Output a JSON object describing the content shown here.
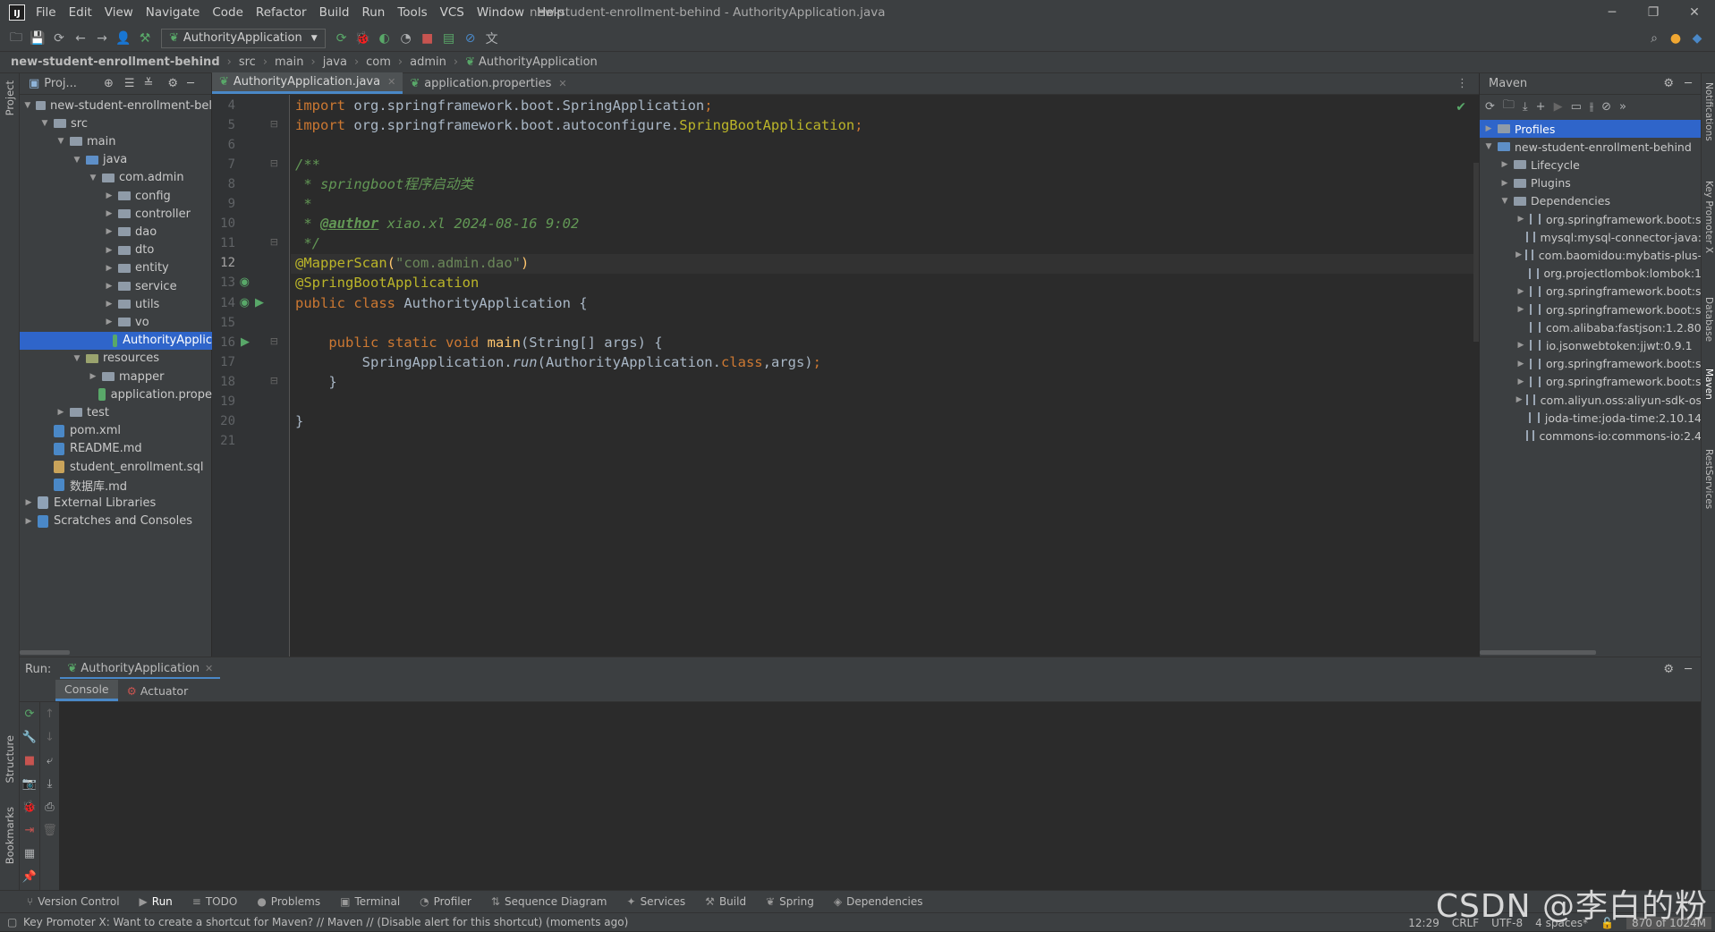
{
  "window": {
    "title": "new-student-enrollment-behind - AuthorityApplication.java",
    "menu": [
      "File",
      "Edit",
      "View",
      "Navigate",
      "Code",
      "Refactor",
      "Build",
      "Run",
      "Tools",
      "VCS",
      "Window",
      "Help"
    ]
  },
  "toolbar": {
    "run_config": "AuthorityApplication"
  },
  "breadcrumb": [
    "new-student-enrollment-behind",
    "src",
    "main",
    "java",
    "com",
    "admin",
    "AuthorityApplication"
  ],
  "left_strip": {
    "project": "Project",
    "structure": "Structure",
    "bookmarks": "Bookmarks"
  },
  "project": {
    "header": "Proj...",
    "tree": [
      {
        "label": "new-student-enrollment-bel",
        "indent": 0,
        "arrow": "v",
        "kind": "folder"
      },
      {
        "label": "src",
        "indent": 1,
        "arrow": "v",
        "kind": "folder"
      },
      {
        "label": "main",
        "indent": 2,
        "arrow": "v",
        "kind": "folder"
      },
      {
        "label": "java",
        "indent": 3,
        "arrow": "v",
        "kind": "blue"
      },
      {
        "label": "com.admin",
        "indent": 4,
        "arrow": "v",
        "kind": "folder"
      },
      {
        "label": "config",
        "indent": 5,
        "arrow": ">",
        "kind": "folder"
      },
      {
        "label": "controller",
        "indent": 5,
        "arrow": ">",
        "kind": "folder"
      },
      {
        "label": "dao",
        "indent": 5,
        "arrow": ">",
        "kind": "folder"
      },
      {
        "label": "dto",
        "indent": 5,
        "arrow": ">",
        "kind": "folder"
      },
      {
        "label": "entity",
        "indent": 5,
        "arrow": ">",
        "kind": "folder"
      },
      {
        "label": "service",
        "indent": 5,
        "arrow": ">",
        "kind": "folder"
      },
      {
        "label": "utils",
        "indent": 5,
        "arrow": ">",
        "kind": "folder"
      },
      {
        "label": "vo",
        "indent": 5,
        "arrow": ">",
        "kind": "folder"
      },
      {
        "label": "AuthorityApplic",
        "indent": 5,
        "arrow": "",
        "kind": "spring",
        "selected": true
      },
      {
        "label": "resources",
        "indent": 3,
        "arrow": "v",
        "kind": "res"
      },
      {
        "label": "mapper",
        "indent": 4,
        "arrow": ">",
        "kind": "folder"
      },
      {
        "label": "application.prope",
        "indent": 4,
        "arrow": "",
        "kind": "props"
      },
      {
        "label": "test",
        "indent": 2,
        "arrow": ">",
        "kind": "folder"
      },
      {
        "label": "pom.xml",
        "indent": 1,
        "arrow": "",
        "kind": "maven"
      },
      {
        "label": "README.md",
        "indent": 1,
        "arrow": "",
        "kind": "md"
      },
      {
        "label": "student_enrollment.sql",
        "indent": 1,
        "arrow": "",
        "kind": "sql"
      },
      {
        "label": "数据库.md",
        "indent": 1,
        "arrow": "",
        "kind": "md"
      },
      {
        "label": "External Libraries",
        "indent": 0,
        "arrow": ">",
        "kind": "lib"
      },
      {
        "label": "Scratches and Consoles",
        "indent": 0,
        "arrow": ">",
        "kind": "scratch"
      }
    ]
  },
  "editor": {
    "tabs": [
      {
        "label": "AuthorityApplication.java",
        "active": true
      },
      {
        "label": "application.properties",
        "active": false
      }
    ],
    "line_numbers": [
      "4",
      "5",
      "6",
      "7",
      "8",
      "9",
      "10",
      "11",
      "12",
      "13",
      "14",
      "15",
      "16",
      "17",
      "18",
      "19",
      "20",
      "21"
    ],
    "current_line": "12",
    "lines": [
      [
        {
          "t": "import ",
          "c": "kw"
        },
        {
          "t": "org.springframework.boot.SpringApplication",
          "c": ""
        },
        {
          "t": ";",
          "c": "kw"
        }
      ],
      [
        {
          "t": "import ",
          "c": "kw"
        },
        {
          "t": "org.springframework.boot.autoconfigure.",
          "c": ""
        },
        {
          "t": "SpringBootApplication",
          "c": "ann"
        },
        {
          "t": ";",
          "c": "kw"
        }
      ],
      [],
      [
        {
          "t": "/**",
          "c": "cmt"
        }
      ],
      [
        {
          "t": " * springboot程序启动类",
          "c": "cmt"
        }
      ],
      [
        {
          "t": " *",
          "c": "cmt"
        }
      ],
      [
        {
          "t": " * ",
          "c": "cmt"
        },
        {
          "t": "@author",
          "c": "tag"
        },
        {
          "t": " xiao.xl 2024-08-16 9:02",
          "c": "cmt"
        }
      ],
      [
        {
          "t": " */",
          "c": "cmt"
        }
      ],
      [
        {
          "t": "@MapperScan",
          "c": "ann"
        },
        {
          "t": "(",
          "c": "fn"
        },
        {
          "t": "\"com.admin.dao\"",
          "c": "str"
        },
        {
          "t": ")",
          "c": "fn"
        }
      ],
      [
        {
          "t": "@SpringBootApplication",
          "c": "ann"
        }
      ],
      [
        {
          "t": "public class ",
          "c": "kw"
        },
        {
          "t": "AuthorityApplication {",
          "c": ""
        }
      ],
      [],
      [
        {
          "t": "    public static void ",
          "c": "kw"
        },
        {
          "t": "main",
          "c": "fn"
        },
        {
          "t": "(String[] args) {",
          "c": ""
        }
      ],
      [
        {
          "t": "        SpringApplication.",
          "c": ""
        },
        {
          "t": "run",
          "c": "it"
        },
        {
          "t": "(AuthorityApplication.",
          "c": ""
        },
        {
          "t": "class",
          "c": "kw"
        },
        {
          "t": ",args)",
          "c": ""
        },
        {
          "t": ";",
          "c": "kw"
        }
      ],
      [
        {
          "t": "    }",
          "c": ""
        }
      ],
      [],
      [
        {
          "t": "}",
          "c": ""
        }
      ],
      []
    ]
  },
  "maven": {
    "header": "Maven",
    "items": [
      {
        "label": "Profiles",
        "indent": 0,
        "arrow": ">",
        "selected": true,
        "kind": "folder"
      },
      {
        "label": "new-student-enrollment-behind",
        "indent": 0,
        "arrow": "v",
        "kind": "maven"
      },
      {
        "label": "Lifecycle",
        "indent": 1,
        "arrow": ">",
        "kind": "folder"
      },
      {
        "label": "Plugins",
        "indent": 1,
        "arrow": ">",
        "kind": "folder"
      },
      {
        "label": "Dependencies",
        "indent": 1,
        "arrow": "v",
        "kind": "folder"
      },
      {
        "label": "org.springframework.boot:s",
        "indent": 2,
        "arrow": ">",
        "kind": "dep"
      },
      {
        "label": "mysql:mysql-connector-java:",
        "indent": 2,
        "arrow": "",
        "kind": "dep"
      },
      {
        "label": "com.baomidou:mybatis-plus-",
        "indent": 2,
        "arrow": ">",
        "kind": "dep"
      },
      {
        "label": "org.projectlombok:lombok:1",
        "indent": 2,
        "arrow": "",
        "kind": "dep"
      },
      {
        "label": "org.springframework.boot:s",
        "indent": 2,
        "arrow": ">",
        "kind": "dep"
      },
      {
        "label": "org.springframework.boot:s",
        "indent": 2,
        "arrow": ">",
        "kind": "dep"
      },
      {
        "label": "com.alibaba:fastjson:1.2.80",
        "indent": 2,
        "arrow": "",
        "kind": "dep"
      },
      {
        "label": "io.jsonwebtoken:jjwt:0.9.1",
        "indent": 2,
        "arrow": ">",
        "kind": "dep"
      },
      {
        "label": "org.springframework.boot:s",
        "indent": 2,
        "arrow": ">",
        "kind": "dep"
      },
      {
        "label": "org.springframework.boot:s",
        "indent": 2,
        "arrow": ">",
        "kind": "dep"
      },
      {
        "label": "com.aliyun.oss:aliyun-sdk-os",
        "indent": 2,
        "arrow": ">",
        "kind": "dep"
      },
      {
        "label": "joda-time:joda-time:2.10.14",
        "indent": 2,
        "arrow": "",
        "kind": "dep"
      },
      {
        "label": "commons-io:commons-io:2.4",
        "indent": 2,
        "arrow": "",
        "kind": "dep"
      }
    ]
  },
  "right_strip": {
    "notifications": "Notifications",
    "key_promoter": "Key Promoter X",
    "database": "Database",
    "maven": "Maven",
    "rest": "RestServices"
  },
  "run": {
    "label": "Run:",
    "config": "AuthorityApplication",
    "tabs": [
      "Console",
      "Actuator"
    ]
  },
  "bottom_tools": [
    {
      "label": "Version Control",
      "icon": "⑂"
    },
    {
      "label": "Run",
      "icon": "▶"
    },
    {
      "label": "TODO",
      "icon": "≡"
    },
    {
      "label": "Problems",
      "icon": "●"
    },
    {
      "label": "Terminal",
      "icon": "▣"
    },
    {
      "label": "Profiler",
      "icon": "◔"
    },
    {
      "label": "Sequence Diagram",
      "icon": "⇅"
    },
    {
      "label": "Services",
      "icon": "✦"
    },
    {
      "label": "Build",
      "icon": "⚒"
    },
    {
      "label": "Spring",
      "icon": "❦"
    },
    {
      "label": "Dependencies",
      "icon": "◈"
    }
  ],
  "status": {
    "message": "Key Promoter X: Want to create a shortcut for Maven? // Maven // (Disable alert for this shortcut) (moments ago)",
    "position": "12:29",
    "line_sep": "CRLF",
    "encoding": "UTF-8",
    "indent": "4 spaces*",
    "memory": "870 of 1024M"
  },
  "watermark": "CSDN @李白的粉"
}
